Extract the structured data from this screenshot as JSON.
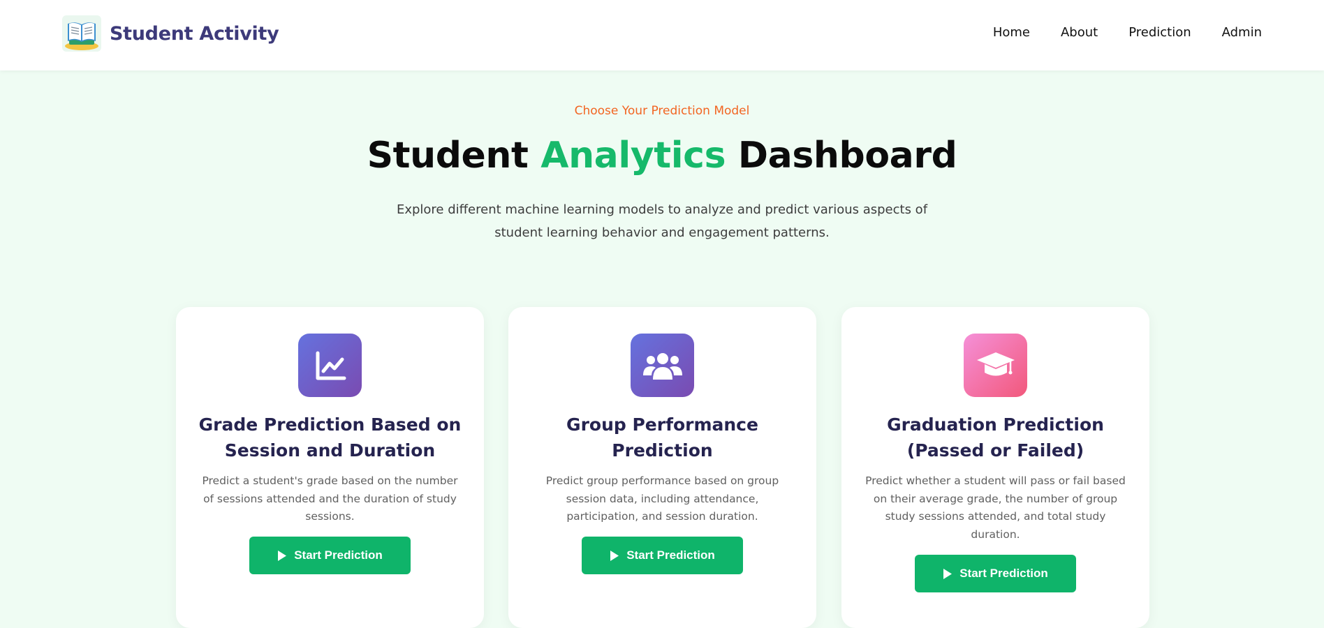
{
  "nav": {
    "brand_name": "Student Activity",
    "logo_icon": "open-book-logo-icon",
    "links": [
      "Home",
      "About",
      "Prediction",
      "Admin"
    ]
  },
  "hero": {
    "eyebrow": "Choose Your Prediction Model",
    "title_part1": "Student",
    "title_accent": "Analytics",
    "title_part2": "Dashboard",
    "subtitle": "Explore different machine learning models to analyze and predict various aspects of student learning behavior and engagement patterns."
  },
  "cards": [
    {
      "icon": "line-chart-icon",
      "title": "Grade Prediction Based on Session and Duration",
      "description": "Predict a student's grade based on the number of sessions attended and the duration of study sessions.",
      "button_label": "Start Prediction"
    },
    {
      "icon": "users-group-icon",
      "title": "Group Performance Prediction",
      "description": "Predict group performance based on group session data, including attendance, participation, and session duration.",
      "button_label": "Start Prediction"
    },
    {
      "icon": "graduation-cap-icon",
      "title": "Graduation Prediction (Passed or Failed)",
      "description": "Predict whether a student will pass or fail based on their average grade, the number of group study sessions attended, and total study duration.",
      "button_label": "Start Prediction"
    }
  ],
  "colors": {
    "accent_green": "#16b96a",
    "button_green": "#0fb46a",
    "eyebrow_orange": "#f26522",
    "brand_purple": "#3d3a7a",
    "page_background": "#effcf3"
  }
}
